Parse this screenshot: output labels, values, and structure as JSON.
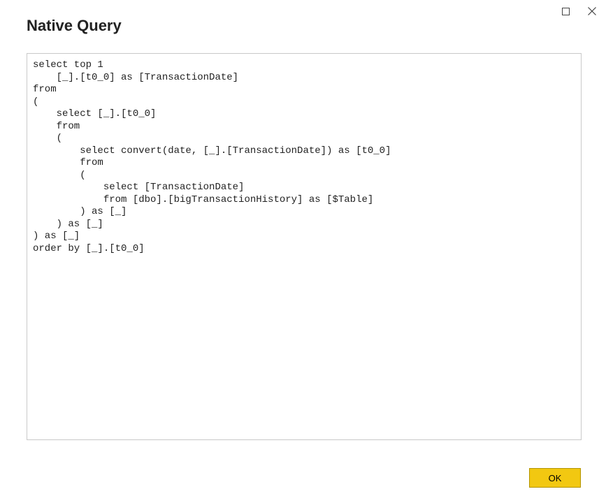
{
  "window": {
    "title": "Native Query",
    "maximize_icon": "maximize",
    "close_icon": "close"
  },
  "query": {
    "sql": "select top 1\n    [_].[t0_0] as [TransactionDate]\nfrom\n(\n    select [_].[t0_0]\n    from\n    (\n        select convert(date, [_].[TransactionDate]) as [t0_0]\n        from\n        (\n            select [TransactionDate]\n            from [dbo].[bigTransactionHistory] as [$Table]\n        ) as [_]\n    ) as [_]\n) as [_]\norder by [_].[t0_0]"
  },
  "footer": {
    "ok_label": "OK"
  }
}
